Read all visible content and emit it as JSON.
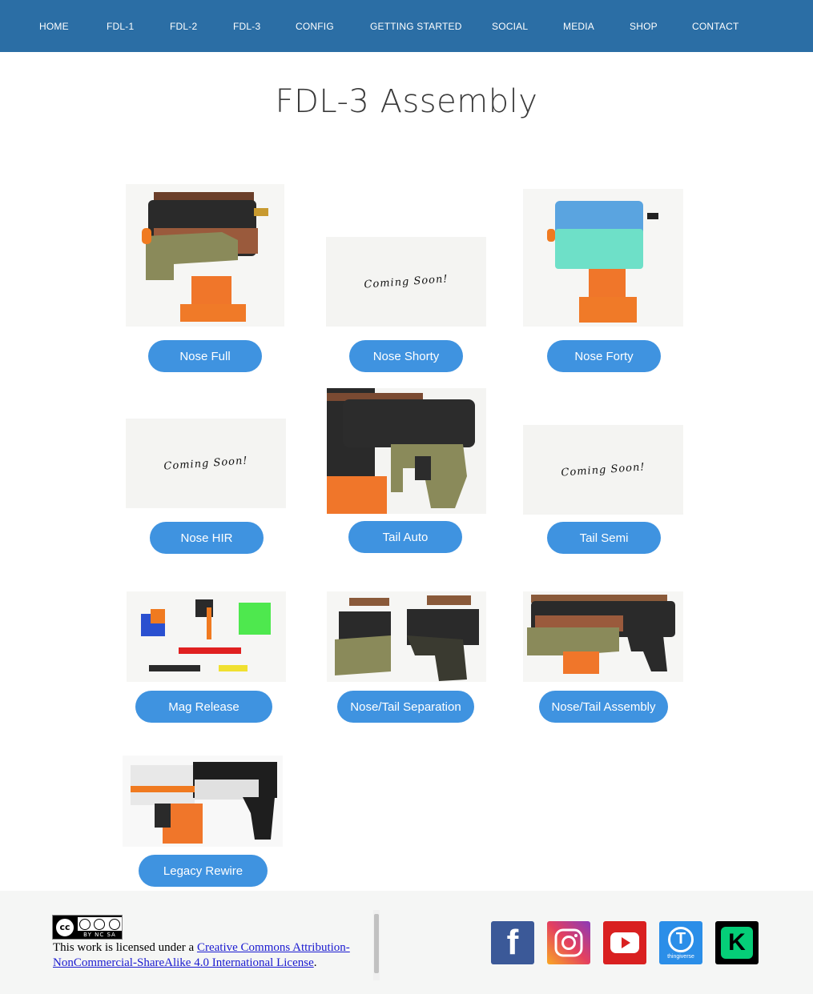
{
  "nav": {
    "items": [
      "HOME",
      "FDL-1",
      "FDL-2",
      "FDL-3",
      "CONFIG",
      "GETTING STARTED",
      "SOCIAL",
      "MEDIA",
      "SHOP",
      "CONTACT"
    ]
  },
  "page": {
    "title": "FDL-3 Assembly"
  },
  "cards": [
    {
      "label": "Nose Full",
      "image": "photo"
    },
    {
      "label": "Nose Shorty",
      "image": "coming-soon",
      "image_text": "Coming Soon!"
    },
    {
      "label": "Nose Forty",
      "image": "photo"
    },
    {
      "label": "Nose HIR",
      "image": "coming-soon",
      "image_text": "Coming Soon!"
    },
    {
      "label": "Tail Auto",
      "image": "photo"
    },
    {
      "label": "Tail Semi",
      "image": "coming-soon",
      "image_text": "Coming Soon!"
    },
    {
      "label": "Mag Release",
      "image": "photo"
    },
    {
      "label": "Nose/Tail Separation",
      "image": "photo"
    },
    {
      "label": "Nose/Tail Assembly",
      "image": "photo"
    },
    {
      "label": "Legacy Rewire",
      "image": "photo"
    }
  ],
  "footer": {
    "cc_badge": {
      "symbol": "cc",
      "terms": "BY NC SA"
    },
    "license_prefix": "This work is licensed under a ",
    "license_link": "Creative Commons Attribution-NonCommercial-ShareAlike 4.0 International License",
    "license_suffix": ".",
    "social": [
      {
        "name": "facebook-icon",
        "glyph": "f",
        "color": "#3b5998"
      },
      {
        "name": "instagram-icon",
        "glyph": "◎",
        "color": "#d62976"
      },
      {
        "name": "youtube-icon",
        "glyph": "▶",
        "color": "#d92020"
      },
      {
        "name": "thingiverse-icon",
        "glyph": "T",
        "caption": "thingiverse",
        "color": "#2b8ee8"
      },
      {
        "name": "kickstarter-icon",
        "glyph": "K",
        "color": "#000000"
      }
    ]
  },
  "colors": {
    "nav_bg": "#2b6ea5",
    "button_bg": "#3f93e0",
    "footer_bg": "#f5f6f5"
  }
}
